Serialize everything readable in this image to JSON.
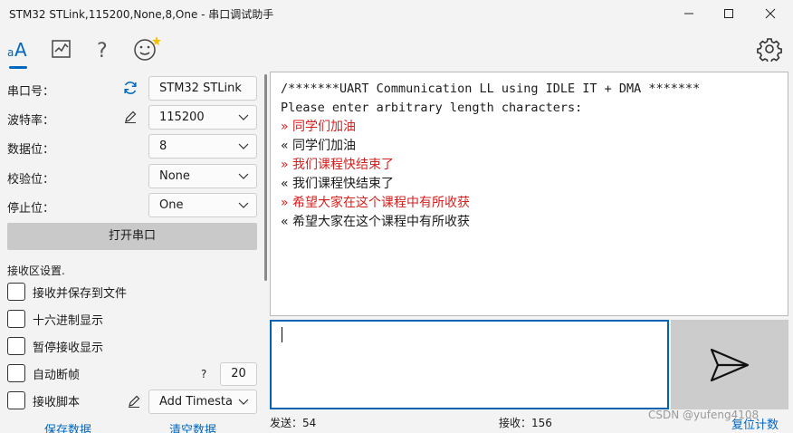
{
  "window": {
    "title": "STM32 STLink,115200,None,8,One - 串口调试助手"
  },
  "settings": {
    "port_label": "串口号：",
    "port_value": "STM32 STLink",
    "baud_label": "波特率：",
    "baud_value": "115200",
    "databits_label": "数据位：",
    "databits_value": "8",
    "parity_label": "校验位：",
    "parity_value": "None",
    "stopbits_label": "停止位：",
    "stopbits_value": "One",
    "open_button": "打开串口"
  },
  "receive_settings": {
    "title": "接收区设置.",
    "save_to_file": "接收并保存到文件",
    "hex_display": "十六进制显示",
    "pause_display": "暂停接收显示",
    "auto_frame": "自动断帧",
    "frame_help": "?",
    "frame_value": "20",
    "recv_script": "接收脚本",
    "script_select": "Add Timesta",
    "save_data": "保存数据",
    "clear_data": "清空数据"
  },
  "receive_lines": [
    {
      "prefix": "",
      "text": "/*******UART Communication LL using IDLE IT + DMA *******",
      "kind": "mono"
    },
    {
      "prefix": "",
      "text": "Please enter arbitrary length characters:",
      "kind": "mono"
    },
    {
      "prefix": "»",
      "text": "同学们加油",
      "kind": "sent"
    },
    {
      "prefix": "«",
      "text": "同学们加油",
      "kind": "recv"
    },
    {
      "prefix": "»",
      "text": "我们课程快结束了",
      "kind": "sent"
    },
    {
      "prefix": "«",
      "text": "我们课程快结束了",
      "kind": "recv"
    },
    {
      "prefix": "»",
      "text": "希望大家在这个课程中有所收获",
      "kind": "sent"
    },
    {
      "prefix": "«",
      "text": "希望大家在这个课程中有所收获",
      "kind": "recv"
    }
  ],
  "status": {
    "sent": "发送：54",
    "received": "接收：156",
    "reset": "复位计数",
    "watermark": "CSDN @yufeng4108"
  },
  "colors": {
    "accent": "#0067c0",
    "sent_text": "#d6201f"
  },
  "icons": {
    "font": "font-icon",
    "chart": "chart-icon",
    "help": "help-icon",
    "emoji": "emoji-icon",
    "settings": "gear-icon",
    "refresh": "refresh-icon",
    "edit": "pen-icon",
    "send": "send-icon"
  }
}
